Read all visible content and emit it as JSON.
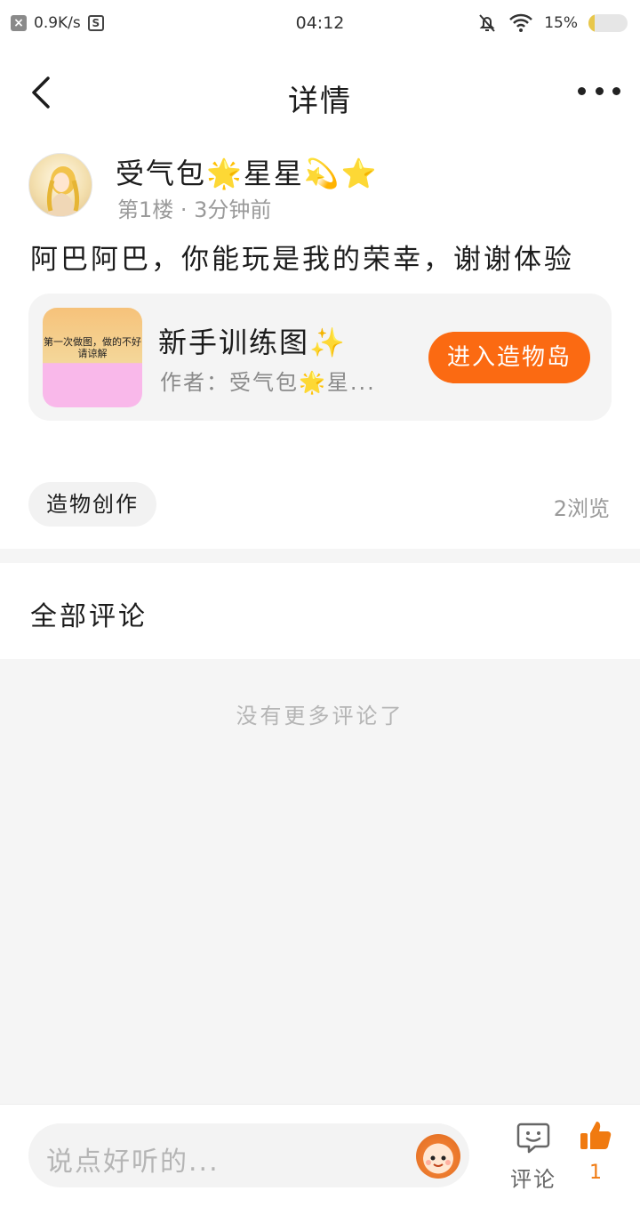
{
  "status_bar": {
    "net_speed": "0.9K/s",
    "time": "04:12",
    "battery": "15%",
    "battery_level": 0.15
  },
  "header": {
    "title": "详情"
  },
  "post": {
    "author": "受气包🌟星星💫⭐",
    "meta": "第1楼 · 3分钟前",
    "body": "阿巴阿巴，你能玩是我的荣幸，谢谢体验"
  },
  "map_card": {
    "thumbnail_text": "第一次做图，做的不好请谅解",
    "title": "新手训练图✨",
    "author": "作者：受气包🌟星...",
    "enter_button": "进入造物岛"
  },
  "tag": {
    "label": "造物创作"
  },
  "views": "2浏览",
  "comments": {
    "title": "全部评论",
    "empty_text": "没有更多评论了"
  },
  "bottom_bar": {
    "input_placeholder": "说点好听的...",
    "comment_label": "评论",
    "like_count": "1"
  },
  "colors": {
    "accent": "#fb6a12",
    "like": "#f07a10"
  }
}
